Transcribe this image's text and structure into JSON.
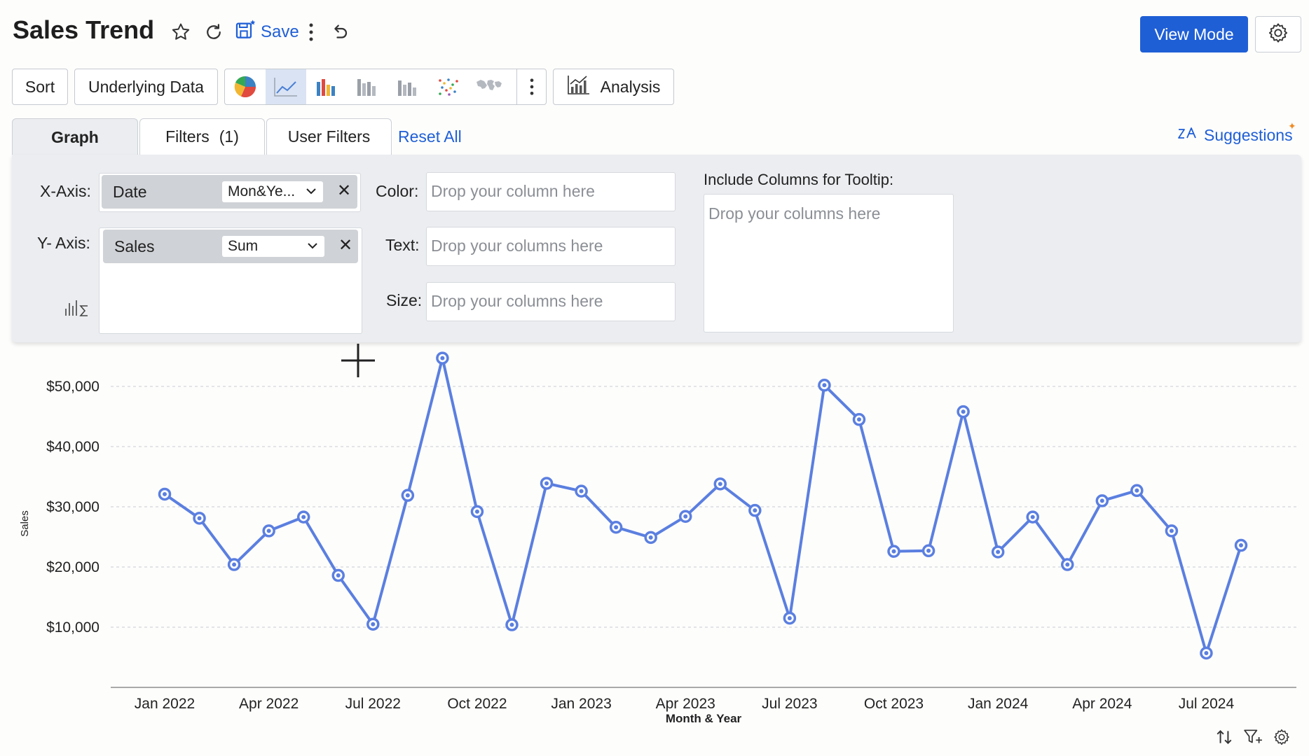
{
  "header": {
    "title": "Sales Trend",
    "save_label": "Save",
    "view_mode_label": "View Mode"
  },
  "toolbar": {
    "sort_label": "Sort",
    "underlying_data_label": "Underlying Data",
    "analysis_label": "Analysis",
    "chart_types": [
      "pie",
      "line",
      "bar",
      "stacked-bar",
      "waterfall",
      "scatter",
      "map"
    ],
    "active_chart_type": "line"
  },
  "tabs": {
    "graph": "Graph",
    "filters": "Filters",
    "filters_count": "(1)",
    "user_filters": "User Filters",
    "reset_all": "Reset All",
    "suggestions": "Suggestions"
  },
  "panel": {
    "x_axis_label": "X-Axis:",
    "x_field": "Date",
    "x_aggregation": "Mon&Ye...",
    "y_axis_label": "Y- Axis:",
    "y_field": "Sales",
    "y_aggregation": "Sum",
    "color_label": "Color:",
    "color_placeholder": "Drop your column here",
    "text_label": "Text:",
    "text_placeholder": "Drop your columns here",
    "size_label": "Size:",
    "size_placeholder": "Drop your columns here",
    "tooltip_label": "Include Columns for Tooltip:",
    "tooltip_placeholder": "Drop your columns here"
  },
  "colors": {
    "accent": "#1f5fd6",
    "line": "#5b7fe0",
    "panel_bg": "#ebedf0"
  },
  "chart_data": {
    "type": "line",
    "xlabel": "Month & Year",
    "ylabel": "Sales",
    "y_ticks": [
      "$10,000",
      "$20,000",
      "$30,000",
      "$40,000",
      "$50,000"
    ],
    "y_tick_values": [
      10000,
      20000,
      30000,
      40000,
      50000
    ],
    "ylim": [
      0,
      55000
    ],
    "x_ticks": [
      {
        "i": 0,
        "label": "Jan 2022"
      },
      {
        "i": 3,
        "label": "Apr 2022"
      },
      {
        "i": 6,
        "label": "Jul 2022"
      },
      {
        "i": 9,
        "label": "Oct 2022"
      },
      {
        "i": 12,
        "label": "Jan 2023"
      },
      {
        "i": 15,
        "label": "Apr 2023"
      },
      {
        "i": 18,
        "label": "Jul 2023"
      },
      {
        "i": 21,
        "label": "Oct 2023"
      },
      {
        "i": 24,
        "label": "Jan 2024"
      },
      {
        "i": 27,
        "label": "Apr 2024"
      },
      {
        "i": 30,
        "label": "Jul 2024"
      }
    ],
    "categories": [
      "Jan 2022",
      "Feb 2022",
      "Mar 2022",
      "Apr 2022",
      "May 2022",
      "Jun 2022",
      "Jul 2022",
      "Aug 2022",
      "Sep 2022",
      "Oct 2022",
      "Nov 2022",
      "Dec 2022",
      "Jan 2023",
      "Feb 2023",
      "Mar 2023",
      "Apr 2023",
      "May 2023",
      "Jun 2023",
      "Jul 2023",
      "Aug 2023",
      "Sep 2023",
      "Oct 2023",
      "Nov 2023",
      "Dec 2023",
      "Jan 2024",
      "Feb 2024",
      "Mar 2024",
      "Apr 2024",
      "May 2024",
      "Jun 2024",
      "Jul 2024",
      "Aug 2024"
    ],
    "values": [
      32100,
      28100,
      20400,
      26000,
      28300,
      18600,
      10500,
      31900,
      54700,
      29200,
      10400,
      33900,
      32600,
      26600,
      24900,
      28400,
      33800,
      29400,
      11500,
      50200,
      44500,
      22600,
      22700,
      45800,
      22500,
      28300,
      20400,
      31000,
      32700,
      26000,
      5700,
      23600
    ],
    "grid": true,
    "legend": "none"
  }
}
